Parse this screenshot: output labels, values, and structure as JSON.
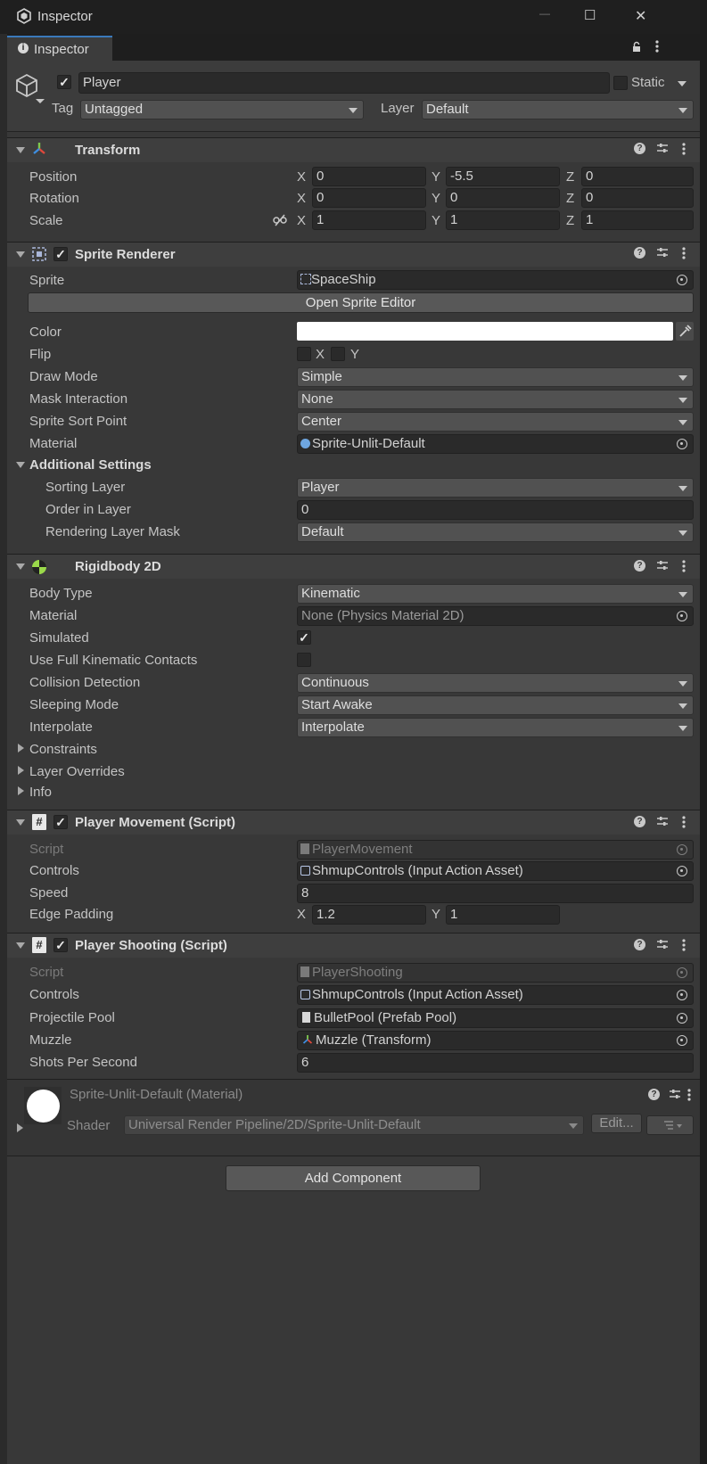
{
  "window": {
    "title": "Inspector",
    "minimize_glyph": "—",
    "maximize_glyph": "☐",
    "close_glyph": "✕"
  },
  "tab": {
    "label": "Inspector",
    "icon": "info-icon"
  },
  "gameobject": {
    "active": true,
    "name": "Player",
    "static_label": "Static",
    "static_checked": false,
    "tag_label": "Tag",
    "tag_value": "Untagged",
    "layer_label": "Layer",
    "layer_value": "Default"
  },
  "transform": {
    "title": "Transform",
    "position": {
      "label": "Position",
      "x": "0",
      "y": "-5.5",
      "z": "0"
    },
    "rotation": {
      "label": "Rotation",
      "x": "0",
      "y": "0",
      "z": "0"
    },
    "scale": {
      "label": "Scale",
      "x": "1",
      "y": "1",
      "z": "1"
    }
  },
  "axis": {
    "x": "X",
    "y": "Y",
    "z": "Z"
  },
  "sprite_renderer": {
    "title": "Sprite Renderer",
    "enabled": true,
    "sprite_label": "Sprite",
    "sprite_value": "SpaceShip",
    "open_editor": "Open Sprite Editor",
    "color_label": "Color",
    "color_value": "#ffffff",
    "flip_label": "Flip",
    "flip_x": "X",
    "flip_y": "Y",
    "draw_mode_label": "Draw Mode",
    "draw_mode_value": "Simple",
    "mask_label": "Mask Interaction",
    "mask_value": "None",
    "sort_point_label": "Sprite Sort Point",
    "sort_point_value": "Center",
    "material_label": "Material",
    "material_value": "Sprite-Unlit-Default",
    "additional_label": "Additional Settings",
    "sorting_layer_label": "Sorting Layer",
    "sorting_layer_value": "Player",
    "order_label": "Order in Layer",
    "order_value": "0",
    "rlm_label": "Rendering Layer Mask",
    "rlm_value": "Default"
  },
  "rigidbody": {
    "title": "Rigidbody 2D",
    "body_type_label": "Body Type",
    "body_type_value": "Kinematic",
    "material_label": "Material",
    "material_value": "None (Physics Material 2D)",
    "simulated_label": "Simulated",
    "simulated": true,
    "full_contacts_label": "Use Full Kinematic Contacts",
    "full_contacts": false,
    "collision_label": "Collision Detection",
    "collision_value": "Continuous",
    "sleeping_label": "Sleeping Mode",
    "sleeping_value": "Start Awake",
    "interpolate_label": "Interpolate",
    "interpolate_value": "Interpolate",
    "constraints_label": "Constraints",
    "layer_overrides_label": "Layer Overrides",
    "info_label": "Info"
  },
  "movement": {
    "title": "Player Movement (Script)",
    "enabled": true,
    "script_label": "Script",
    "script_value": "PlayerMovement",
    "controls_label": "Controls",
    "controls_value": "ShmupControls (Input Action Asset)",
    "speed_label": "Speed",
    "speed_value": "8",
    "edge_label": "Edge Padding",
    "edge_x": "1.2",
    "edge_y": "1"
  },
  "shooting": {
    "title": "Player Shooting (Script)",
    "enabled": true,
    "script_label": "Script",
    "script_value": "PlayerShooting",
    "controls_label": "Controls",
    "controls_value": "ShmupControls (Input Action Asset)",
    "pool_label": "Projectile Pool",
    "pool_value": "BulletPool (Prefab Pool)",
    "muzzle_label": "Muzzle",
    "muzzle_value": "Muzzle (Transform)",
    "sps_label": "Shots Per Second",
    "sps_value": "6"
  },
  "material_preview": {
    "name": "Sprite-Unlit-Default (Material)",
    "shader_label": "Shader",
    "shader_value": "Universal Render Pipeline/2D/Sprite-Unlit-Default",
    "edit_label": "Edit..."
  },
  "add_component": "Add Component"
}
